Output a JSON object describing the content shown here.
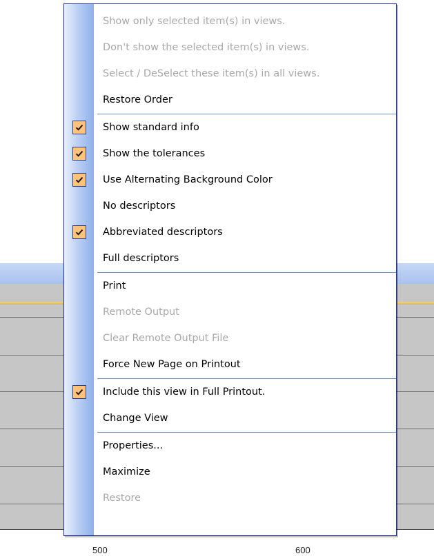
{
  "menu": {
    "items": [
      {
        "label": "Show only selected item(s) in views.",
        "enabled": false,
        "checked": false
      },
      {
        "label": "Don't show the selected item(s) in views.",
        "enabled": false,
        "checked": false
      },
      {
        "label": "Select / DeSelect these item(s) in all views.",
        "enabled": false,
        "checked": false
      },
      {
        "label": "Restore Order",
        "enabled": true,
        "checked": false
      },
      {
        "label": "Show standard info",
        "enabled": true,
        "checked": true
      },
      {
        "label": "Show the tolerances",
        "enabled": true,
        "checked": true
      },
      {
        "label": "Use Alternating Background Color",
        "enabled": true,
        "checked": true
      },
      {
        "label": "No descriptors",
        "enabled": true,
        "checked": false
      },
      {
        "label": "Abbreviated descriptors",
        "enabled": true,
        "checked": true
      },
      {
        "label": "Full descriptors",
        "enabled": true,
        "checked": false
      },
      {
        "label": "Print",
        "enabled": true,
        "checked": false
      },
      {
        "label": "Remote Output",
        "enabled": false,
        "checked": false
      },
      {
        "label": "Clear Remote Output File",
        "enabled": false,
        "checked": false
      },
      {
        "label": "Force New Page on Printout",
        "enabled": true,
        "checked": false
      },
      {
        "label": "Include this view in Full Printout.",
        "enabled": true,
        "checked": true
      },
      {
        "label": "Change View",
        "enabled": true,
        "checked": false
      },
      {
        "label": "Properties...",
        "enabled": true,
        "checked": false
      },
      {
        "label": "Maximize",
        "enabled": true,
        "checked": false
      },
      {
        "label": "Restore",
        "enabled": false,
        "checked": false
      }
    ],
    "separators_after": [
      3,
      9,
      13,
      15
    ]
  },
  "axis": {
    "ticks": [
      "500",
      "600"
    ]
  },
  "colors": {
    "check_fill": "#ffc37a",
    "menu_border": "#1a2a9c",
    "disabled_text": "#a8a8a8",
    "separator": "#6e8fd6"
  }
}
